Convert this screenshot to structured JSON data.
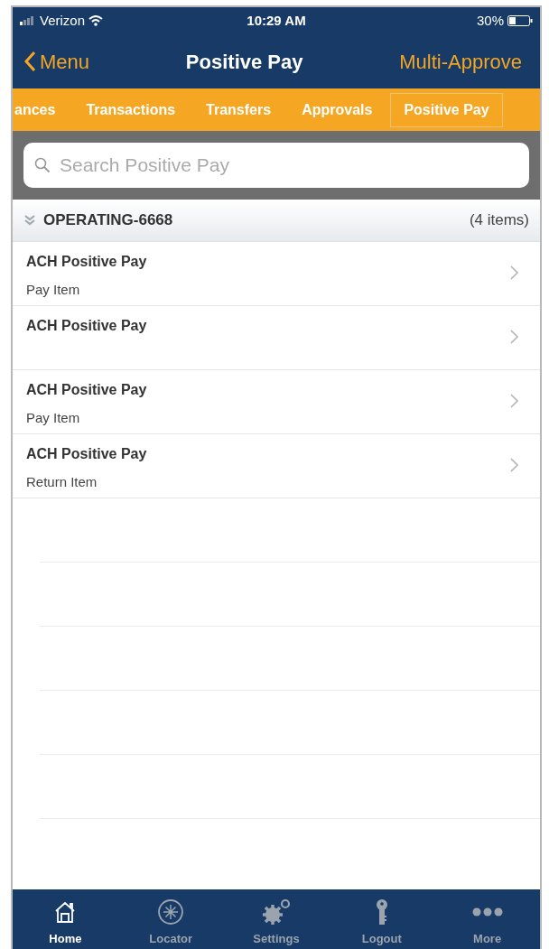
{
  "status_bar": {
    "carrier": "Verizon",
    "time": "10:29 AM",
    "battery": "30%"
  },
  "nav": {
    "back": "Menu",
    "title": "Positive Pay",
    "action": "Multi-Approve"
  },
  "tabs": [
    {
      "label": "ances",
      "selected": false
    },
    {
      "label": "Transactions",
      "selected": false
    },
    {
      "label": "Transfers",
      "selected": false
    },
    {
      "label": "Approvals",
      "selected": false
    },
    {
      "label": "Positive Pay",
      "selected": true
    }
  ],
  "search": {
    "placeholder": "Search Positive Pay"
  },
  "group": {
    "name": "OPERATING-6668",
    "count": "(4 items)",
    "expanded": true,
    "items": [
      {
        "title": "ACH Positive Pay",
        "subtitle": "Pay Item"
      },
      {
        "title": "ACH Positive Pay"
      },
      {
        "title": "ACH Positive Pay",
        "subtitle": "Pay Item"
      },
      {
        "title": "ACH Positive Pay",
        "subtitle": "Return Item"
      }
    ]
  },
  "tab_bar": [
    {
      "kind": "home",
      "label": "Home",
      "selected": true
    },
    {
      "kind": "locator",
      "label": "Locator",
      "selected": false
    },
    {
      "kind": "settings",
      "label": "Settings",
      "selected": false
    },
    {
      "kind": "logout",
      "label": "Logout",
      "selected": false
    },
    {
      "kind": "more",
      "label": "More",
      "selected": false
    }
  ]
}
